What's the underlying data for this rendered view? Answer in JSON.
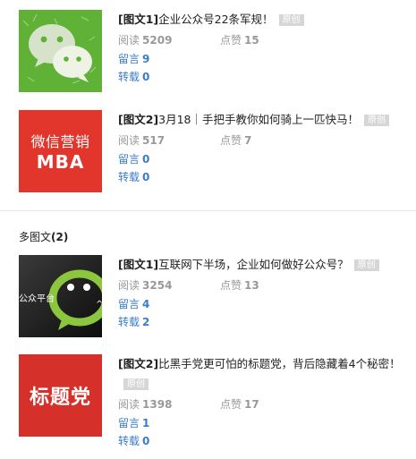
{
  "articles": [
    {
      "title_tag": "[图文1]",
      "title_text": "企业公众号22条军规！",
      "badge": "原创",
      "read_label": "阅读",
      "read_count": "5209",
      "like_label": "点赞",
      "like_count": "15",
      "comment_label": "留言",
      "comment_count": "9",
      "share_label": "转载",
      "share_count": "0",
      "thumb_icon": "wechat-logo-icon"
    },
    {
      "title_tag": "[图文2]",
      "title_text": "3月18｜手把手教你如何骑上一匹快马！",
      "badge": "原创",
      "read_label": "阅读",
      "read_count": "517",
      "like_label": "点赞",
      "like_count": "7",
      "comment_label": "留言",
      "comment_count": "0",
      "share_label": "转载",
      "share_count": "0",
      "thumb_line1": "微信营销",
      "thumb_line2": "MBA"
    },
    {
      "title_tag": "[图文1]",
      "title_text": "互联网下半场，企业如何做好公众号？",
      "badge": "原创",
      "read_label": "阅读",
      "read_count": "3254",
      "like_label": "点赞",
      "like_count": "13",
      "comment_label": "留言",
      "comment_count": "4",
      "share_label": "转载",
      "share_count": "2",
      "thumb_text": "公众平台",
      "thumb_icon": "wechat-chat-icon"
    },
    {
      "title_tag": "[图文2]",
      "title_text": "比黑手党更可怕的标题党，背后隐藏着4个秘密！",
      "badge": "原创",
      "read_label": "阅读",
      "read_count": "1398",
      "like_label": "点赞",
      "like_count": "17",
      "comment_label": "留言",
      "comment_count": "1",
      "share_label": "转载",
      "share_count": "0",
      "thumb_text": "标题党"
    }
  ],
  "section": {
    "label": "多图文",
    "count": "(2)"
  },
  "colors": {
    "green": "#5fb236",
    "red": "#d6302b",
    "link": "#3a7cc9",
    "badge": "#d6d6d6"
  }
}
